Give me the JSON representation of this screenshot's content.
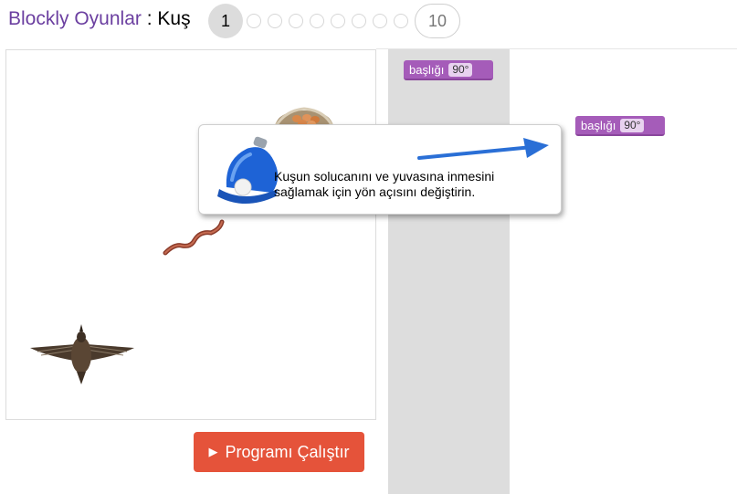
{
  "header": {
    "app_title": "Blockly Oyunlar",
    "separator": ":",
    "game_name": "Kuş",
    "current_level": "1",
    "last_level": "10"
  },
  "workspace": {
    "toolbox_block": {
      "label": "başlığı",
      "value": "90°"
    },
    "workspace_block": {
      "label": "başlığı",
      "value": "90°"
    }
  },
  "hint": {
    "text_line1": "Kuşun solucanını ve yuvasına inmesini",
    "text_line2": "sağlamak için yön açısını değiştirin."
  },
  "run_button": {
    "label": "Programı Çalıştır",
    "icon": "play-icon"
  },
  "colors": {
    "title": "#6b3fa0",
    "run_button": "#e5533a",
    "block": "#a55cb9",
    "arrow": "#2a6fd6",
    "bell": "#1e63d6"
  }
}
